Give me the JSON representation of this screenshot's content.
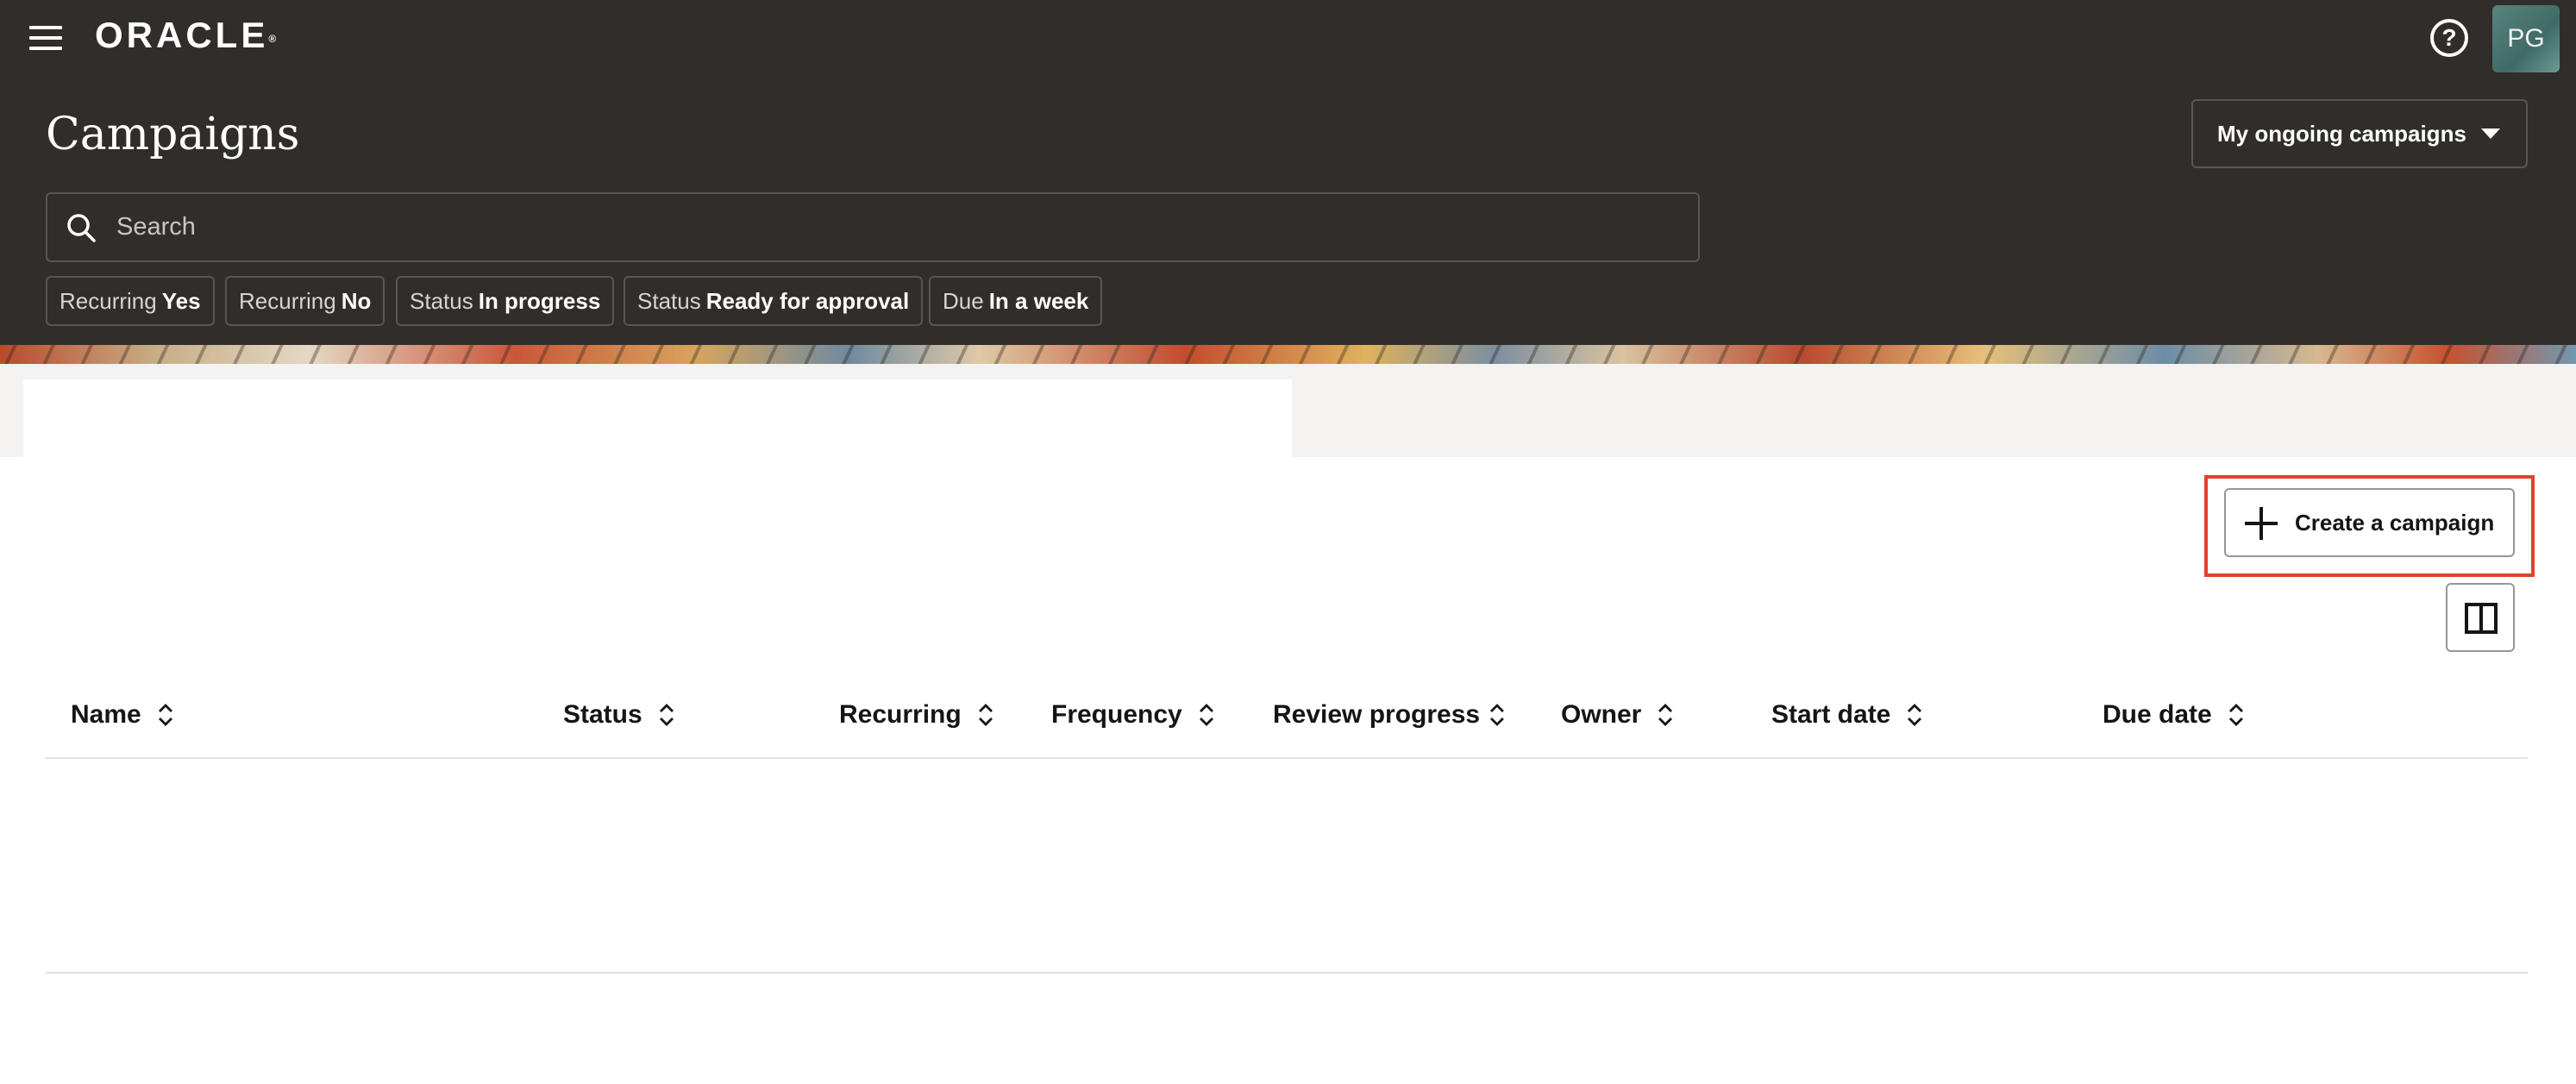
{
  "header": {
    "logo_text": "ORACLE",
    "logo_mark": "®",
    "menu_icon": "hamburger-menu-icon",
    "help_icon": "help-circle-icon",
    "help_glyph": "?",
    "avatar_initials": "PG",
    "background_color": "#312d2a"
  },
  "page": {
    "title": "Campaigns",
    "view_selector": {
      "selected": "My ongoing campaigns",
      "icon": "caret-down-icon"
    }
  },
  "search": {
    "placeholder": "Search",
    "icon": "search-icon"
  },
  "filters": [
    {
      "key": "Recurring",
      "value": "Yes"
    },
    {
      "key": "Recurring",
      "value": "No"
    },
    {
      "key": "Status",
      "value": "In progress"
    },
    {
      "key": "Status",
      "value": "Ready for approval"
    },
    {
      "key": "Due",
      "value": "In a week"
    }
  ],
  "toolbar": {
    "create_label": "Create a campaign",
    "create_icon": "plus-icon",
    "columns_icon": "column-layout-icon",
    "highlight_color": "#e2412e"
  },
  "table": {
    "columns": [
      "Name",
      "Status",
      "Recurring",
      "Frequency",
      "Review progress",
      "Owner",
      "Start date",
      "Due date"
    ],
    "sort_icon": "sort-up-down-icon",
    "rows": []
  }
}
